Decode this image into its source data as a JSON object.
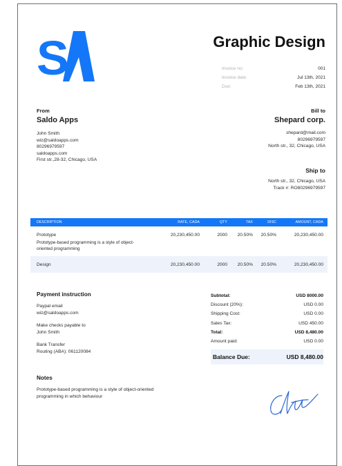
{
  "header": {
    "title": "Graphic Design",
    "meta": [
      {
        "label": "Invoice no:",
        "value": "001"
      },
      {
        "label": "Invoice date:",
        "value": "Jul 13th, 2021"
      },
      {
        "label": "Due:",
        "value": "Feb 13th, 2021"
      }
    ]
  },
  "brand": {
    "logo_letters": "SA",
    "color": "#1477f8"
  },
  "from": {
    "heading": "From",
    "name": "Saldo Apps",
    "lines": [
      "John Smith",
      "wiz@saldoapps.com",
      "80296979597",
      "saldoapps.com",
      "First str.,28-32, Chicago, USA"
    ]
  },
  "bill_to": {
    "heading": "Bill to",
    "name": "Shepard corp.",
    "lines": [
      "shepard@mail.com",
      "80296979597",
      "North str., 32, Chicago, USA"
    ]
  },
  "ship_to": {
    "heading": "Ship to",
    "lines": [
      "North str., 32, Chicago, USA",
      "Track #: RO80296979597"
    ]
  },
  "table": {
    "headers": {
      "desc": "DESCRIPTION",
      "rate": "RATE, CADA",
      "qty": "QTY",
      "tax": "TAX",
      "disc": "DISC",
      "amount": "AMOUNT, CADA"
    },
    "rows": [
      {
        "name": "Prototype",
        "description": "Prototype-based programming is a style of object-oriented programming",
        "rate": "20,230,450.00",
        "qty": "2000",
        "tax": "20.50%",
        "disc": "20.50%",
        "amount": "20,230,450.00"
      },
      {
        "name": "Design",
        "description": "",
        "rate": "20,230,450.00",
        "qty": "2000",
        "tax": "20.50%",
        "disc": "20.50%",
        "amount": "20,230,450.00"
      }
    ]
  },
  "payment": {
    "heading": "Payment instruction",
    "groups": [
      [
        "Paypal email",
        "wiz@saldoapps.com"
      ],
      [
        "Make checks payable to",
        "John Smith"
      ],
      [
        "Bank Transfer",
        "Routing (ABA): 061120084"
      ]
    ]
  },
  "totals": {
    "rows": [
      {
        "label": "Subtotal:",
        "value": "USD 8000.00",
        "bold": true
      },
      {
        "label": "Discount (20%):",
        "value": "USD 0.00",
        "bold": false
      },
      {
        "label": "Shipping Cost:",
        "value": "USD 0.00",
        "bold": false
      },
      {
        "label": "Sales Tax:",
        "value": "USD 450.00",
        "bold": false
      },
      {
        "label": "Total:",
        "value": "USD 8,480.00",
        "bold": true
      },
      {
        "label": "Amount paid:",
        "value": "USD 0.00",
        "bold": false
      }
    ],
    "balance_label": "Balance Due:",
    "balance_value": "USD 8,480.00"
  },
  "notes": {
    "heading": "Notes",
    "text": "Prototype-based programming is a style of object-oriented programming in which behaviour"
  },
  "signature": {
    "icon": "signature-icon",
    "color": "#2b66d6"
  }
}
